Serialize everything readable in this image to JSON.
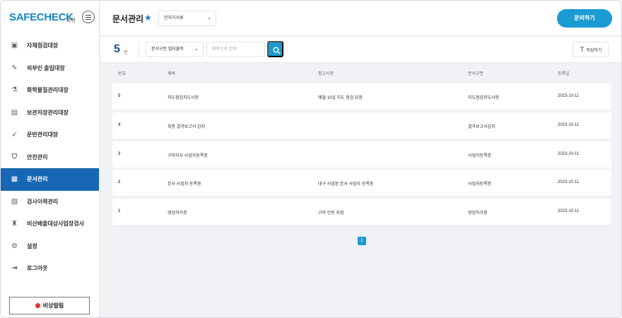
{
  "brand": {
    "name": "SAFECHECK",
    "sub": "화학"
  },
  "sidebar": {
    "items": [
      {
        "label": "자체점검대장",
        "icon": "clipboard-check-icon",
        "glyph": "▣"
      },
      {
        "label": "외부인 출입대장",
        "icon": "edit-document-icon",
        "glyph": "✎"
      },
      {
        "label": "화학물질관리대장",
        "icon": "flask-icon",
        "glyph": "⚗"
      },
      {
        "label": "보관저장관리대장",
        "icon": "archive-box-icon",
        "glyph": "▤"
      },
      {
        "label": "운반관리대장",
        "icon": "transport-icon",
        "glyph": "➶"
      },
      {
        "label": "안전관리",
        "icon": "shield-icon",
        "glyph": "⛉"
      },
      {
        "label": "문서관리",
        "icon": "document-icon",
        "glyph": "▦",
        "active": true
      },
      {
        "label": "검사이력관리",
        "icon": "inspection-history-icon",
        "glyph": "▧"
      },
      {
        "label": "비산배출대상사업장검사",
        "icon": "factory-icon",
        "glyph": "♜"
      },
      {
        "label": "설정",
        "icon": "gear-icon",
        "glyph": "⚙"
      },
      {
        "label": "로그아웃",
        "icon": "logout-icon",
        "glyph": "⇥"
      }
    ],
    "emergency_label": "비상알림"
  },
  "header": {
    "title": "문서관리",
    "select_value": "인허가서류",
    "primary_button": "문의하기"
  },
  "filter": {
    "count": "5",
    "count_unit": "건",
    "type_select": "문서구분 필터출력",
    "search_placeholder": "제목으로 검색",
    "write_label": "작성하기"
  },
  "table": {
    "columns": [
      "번호",
      "제목",
      "참고사항",
      "문서구분",
      "등록일"
    ],
    "rows": [
      {
        "no": "5",
        "title": "지도점검지도사항",
        "note": "매월 10일 지도 점검 요함",
        "type": "지도점검지도사항",
        "date": "2023-10-11"
      },
      {
        "no": "4",
        "title": "최종 결과보고서 감지",
        "note": "",
        "type": "결과보고서감지",
        "date": "2023-10-11"
      },
      {
        "no": "3",
        "title": "구미지사 사업자등록증",
        "note": "",
        "type": "사업자등록증",
        "date": "2023-10-11"
      },
      {
        "no": "2",
        "title": "본사 사업자 등록증",
        "note": "대구 사업장 본사 사업자 등록증",
        "type": "사업자등록증",
        "date": "2023-10-11"
      },
      {
        "no": "1",
        "title": "영업허가증",
        "note": "구미 인동 지점",
        "type": "영업허가증",
        "date": "2023-10-11"
      }
    ]
  },
  "pagination": {
    "current": "1"
  },
  "colors": {
    "accent": "#1a9bd3",
    "active_menu": "#1767b4",
    "brand": "#1486c9",
    "alert": "#e5322d"
  }
}
